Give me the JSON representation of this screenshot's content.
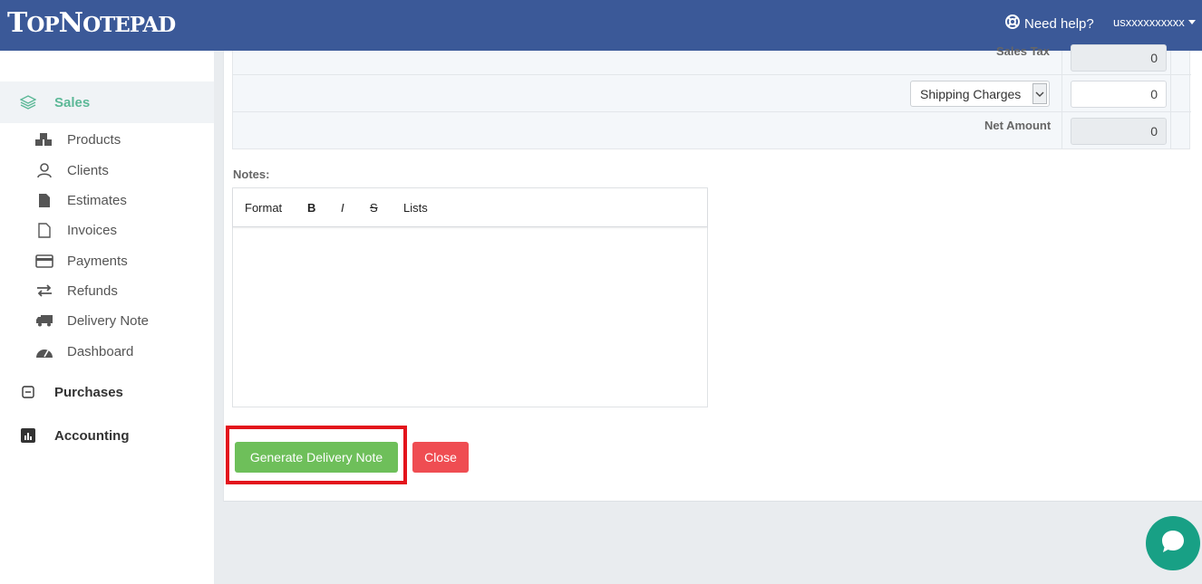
{
  "header": {
    "logo": {
      "first": "T",
      "first_rest": "OP",
      "second": "N",
      "second_rest": "OTEPAD"
    },
    "help_label": "Need help?",
    "user_label": "usxxxxxxxxxx"
  },
  "sidebar": {
    "sales_label": "Sales",
    "items": [
      {
        "label": "Products",
        "icon": "cubes-icon"
      },
      {
        "label": "Clients",
        "icon": "user-icon"
      },
      {
        "label": "Estimates",
        "icon": "file-icon"
      },
      {
        "label": "Invoices",
        "icon": "file-outline-icon"
      },
      {
        "label": "Payments",
        "icon": "credit-card-icon"
      },
      {
        "label": "Refunds",
        "icon": "exchange-icon"
      },
      {
        "label": "Delivery Note",
        "icon": "truck-icon"
      },
      {
        "label": "Dashboard",
        "icon": "dashboard-icon"
      }
    ],
    "purchases_label": "Purchases",
    "accounting_label": "Accounting"
  },
  "totals": {
    "sales_tax_label": "Sales Tax",
    "sales_tax_value": "0",
    "shipping_select": "Shipping Charges",
    "shipping_value": "0",
    "net_amount_label": "Net Amount",
    "net_amount_value": "0"
  },
  "notes": {
    "label": "Notes:",
    "toolbar": {
      "format": "Format",
      "bold": "B",
      "italic": "I",
      "strike": "S",
      "lists": "Lists"
    }
  },
  "actions": {
    "generate_label": "Generate Delivery Note",
    "close_label": "Close"
  },
  "colors": {
    "header": "#3b5998",
    "sales_accent": "#5cb897",
    "generate": "#6ebf5a",
    "close": "#ef4d52",
    "chat": "#18a085",
    "highlight": "#e3141c"
  }
}
